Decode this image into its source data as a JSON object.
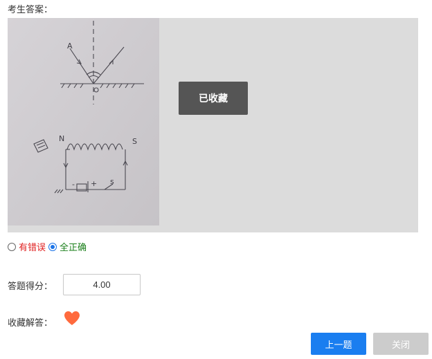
{
  "answer_section": {
    "title": "考生答案：",
    "collected_label": "已收藏",
    "sketch_labels": {
      "ray_label": "A",
      "north": "N",
      "south": "S",
      "minus": "-",
      "plus": "+",
      "switch": "s"
    }
  },
  "judgement": {
    "options": [
      {
        "label": "有错误",
        "checked": false,
        "color": "#e02020"
      },
      {
        "label": "全正确",
        "checked": true,
        "color": "#1a7f1a"
      }
    ]
  },
  "score": {
    "label": "答题得分：",
    "value": "4.00"
  },
  "favorite": {
    "label": "收藏解答：",
    "icon": "heart-icon",
    "color": "#ff6a3d"
  },
  "buttons": {
    "prev": "上一题",
    "close": "关闭"
  },
  "colors": {
    "primary": "#1a7ef0",
    "disabled": "#cccccc",
    "badge": "#555555"
  }
}
